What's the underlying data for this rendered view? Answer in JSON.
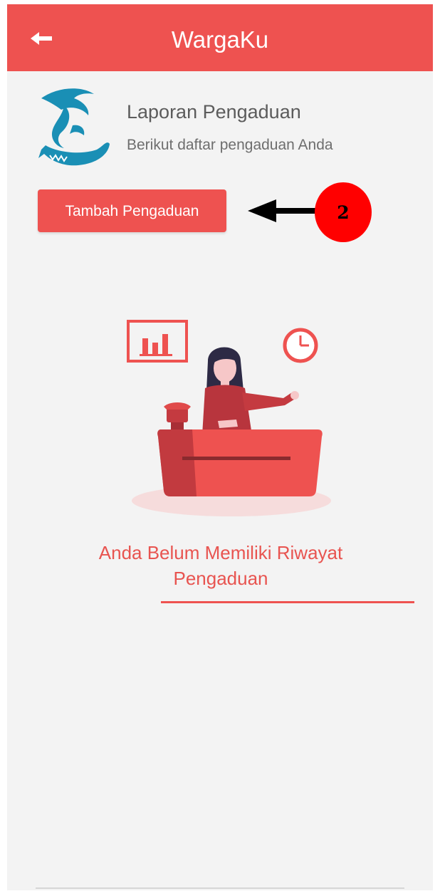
{
  "app_bar": {
    "title": "WargaKu",
    "back_icon": "arrow-left-icon"
  },
  "header": {
    "logo": "dolphin-crocodile-logo",
    "title": "Laporan Pengaduan",
    "subtitle": "Berikut daftar pengaduan Anda"
  },
  "actions": {
    "add_complaint_label": "Tambah Pengaduan"
  },
  "annotation": {
    "step_number": "2",
    "arrow_icon": "arrow-left-icon"
  },
  "empty_state": {
    "illustration": "receptionist-desk-illustration",
    "message": "Anda Belum Memiliki Riwayat Pengaduan"
  },
  "colors": {
    "primary": "#ee5250",
    "background": "#f3f3f3",
    "logo_blue": "#1a8fb5",
    "annotation_red": "#ff0000"
  }
}
